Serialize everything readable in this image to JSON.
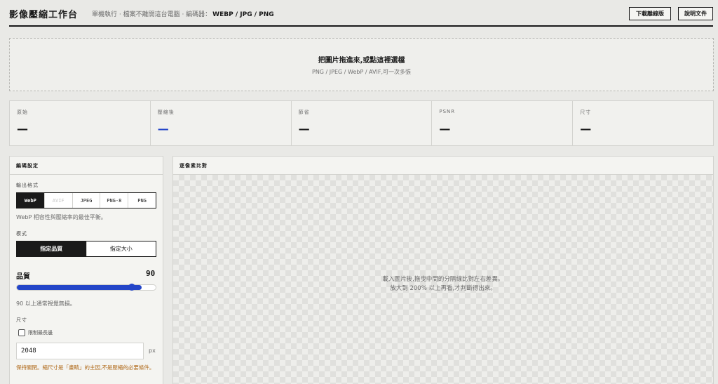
{
  "header": {
    "title": "影像壓縮工作台",
    "subtitle": "單機執行 · 檔案不離開這台電腦 · 編碼器：",
    "codecs": "WEBP / JPG / PNG",
    "offline_button": "下載離線版",
    "help_button": "說明文件"
  },
  "dropzone": {
    "title": "把圖片拖進來,或點這裡選檔",
    "subtitle": "PNG / JPEG / WebP / AVIF,可一次多張"
  },
  "stats": [
    {
      "label": "原始",
      "value": "—"
    },
    {
      "label": "壓縮後",
      "value": "—"
    },
    {
      "label": "節省",
      "value": "—"
    },
    {
      "label": "PSNR",
      "value": "—"
    },
    {
      "label": "尺寸",
      "value": "—"
    }
  ],
  "settings": {
    "title": "編碼設定",
    "format_label": "輸出格式",
    "formats": [
      "WebP",
      "AVIF",
      "JPEG",
      "PNG-8",
      "PNG"
    ],
    "format_hint": "WebP 相容性與壓縮率的最佳平衡。",
    "mode_label": "模式",
    "modes": [
      "指定品質",
      "指定大小"
    ],
    "quality_label": "品質",
    "quality_value": "90",
    "quality_fraction": 0.9,
    "quality_hint": "90 以上通常視覺無損。",
    "size_label": "尺寸",
    "limit_long_edge": "限制最長邊",
    "size_value": "2048",
    "size_unit": "px",
    "size_warning": "保持關閉。縮尺寸是「畫睛」的主因,不是壓縮的必要條件。"
  },
  "compare": {
    "title": "逐像素比對",
    "message_line1": "載入圖片後,拖曳中間的分隔線比對左右差異。",
    "message_line2": "放大到 200% 以上再看,才判斷得出來。"
  },
  "colors": {
    "accent": "#2345c8",
    "warning": "#b06a1a"
  }
}
